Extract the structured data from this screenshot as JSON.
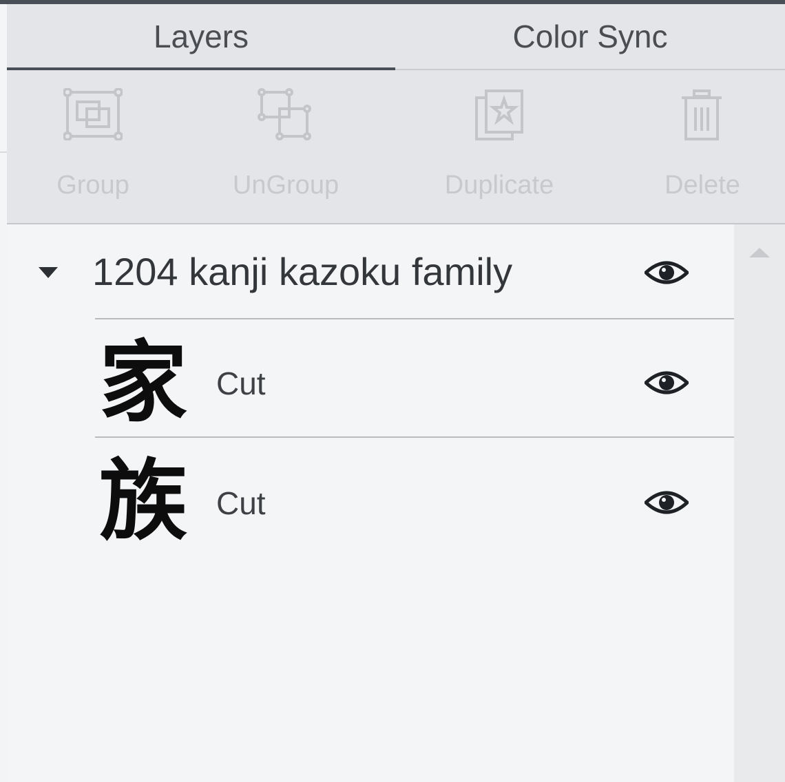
{
  "tabs": [
    {
      "label": "Layers",
      "active": true
    },
    {
      "label": "Color Sync",
      "active": false
    }
  ],
  "toolbar": {
    "group": {
      "label": "Group",
      "icon": "group-icon",
      "enabled": false
    },
    "ungroup": {
      "label": "UnGroup",
      "icon": "ungroup-icon",
      "enabled": false
    },
    "duplicate": {
      "label": "Duplicate",
      "icon": "duplicate-icon",
      "enabled": false
    },
    "delete": {
      "label": "Delete",
      "icon": "trash-icon",
      "enabled": false
    }
  },
  "layers": {
    "group": {
      "name": "1204 kanji kazoku family",
      "expanded": true,
      "visible": true,
      "children": [
        {
          "glyph": "家",
          "operation": "Cut",
          "visible": true
        },
        {
          "glyph": "族",
          "operation": "Cut",
          "visible": true
        }
      ]
    }
  },
  "colors": {
    "accent": "#4a4f57",
    "panel_bg": "#f4f5f7",
    "toolbar_bg": "#e4e5e8",
    "disabled_text": "#c7c9cc"
  }
}
